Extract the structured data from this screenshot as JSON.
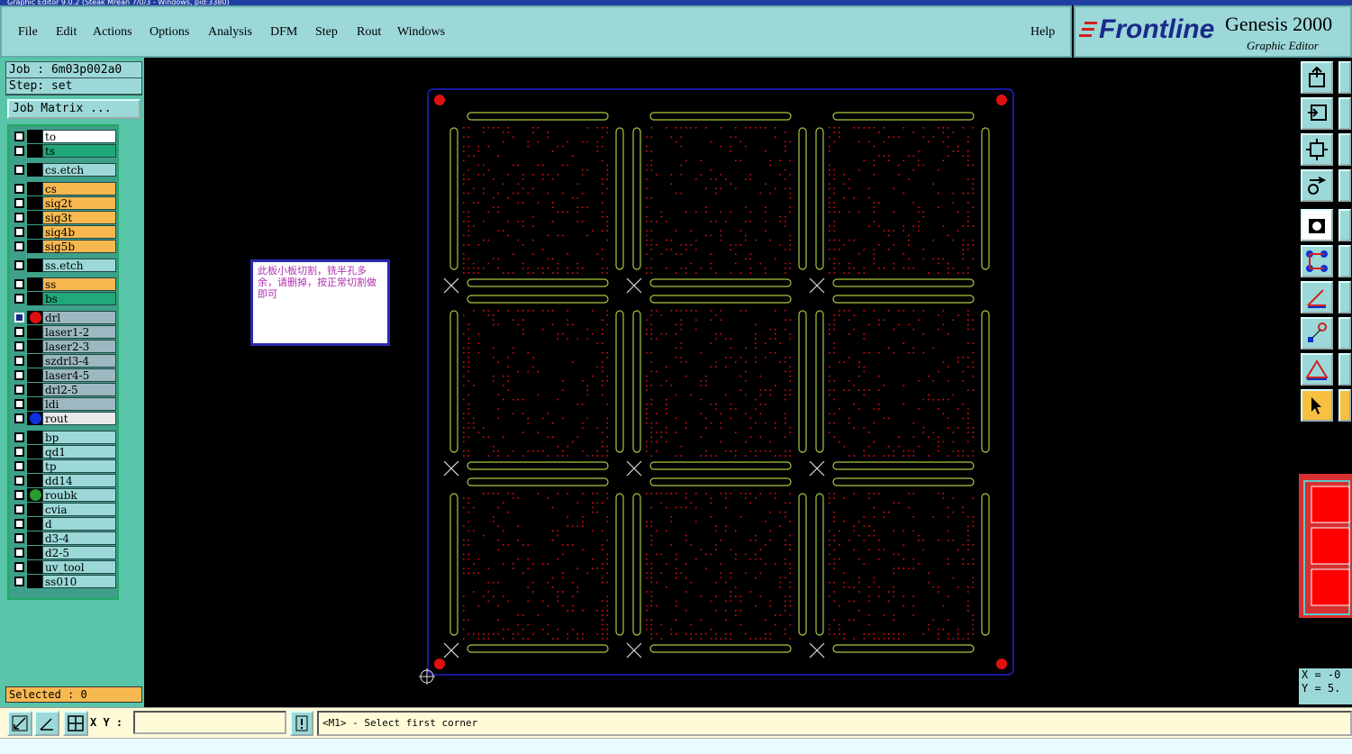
{
  "window": {
    "title": "Graphic Editor 9.0.2 (Steak Mrean 7/0/3 - Windows, pid:3380)"
  },
  "menu": {
    "items": [
      {
        "label": "File"
      },
      {
        "label": "Edit"
      },
      {
        "label": "Actions"
      },
      {
        "label": "Options"
      },
      {
        "label": "Analysis"
      },
      {
        "label": "DFM"
      },
      {
        "label": "Step"
      },
      {
        "label": "Rout"
      },
      {
        "label": "Windows"
      }
    ],
    "help": "Help"
  },
  "brand": {
    "logo": "Frontline",
    "product": "Genesis 2000",
    "subtitle": "Graphic Editor"
  },
  "job": {
    "job_line": "Job : 6m03p002a0",
    "step_line": "Step: set",
    "matrix_button": "Job Matrix ..."
  },
  "layers": [
    {
      "name": "to",
      "color": "#ffffff",
      "dot": ""
    },
    {
      "name": "ts",
      "color": "#20a878",
      "dot": ""
    },
    {
      "name": "cs.etch",
      "color": "#9cd8d8",
      "dot": ""
    },
    {
      "name": "cs",
      "color": "#f8b850",
      "dot": ""
    },
    {
      "name": "sig2t",
      "color": "#f8b850",
      "dot": ""
    },
    {
      "name": "sig3t",
      "color": "#f8b850",
      "dot": ""
    },
    {
      "name": "sig4b",
      "color": "#f8b850",
      "dot": ""
    },
    {
      "name": "sig5b",
      "color": "#f8b850",
      "dot": ""
    },
    {
      "name": "ss.etch",
      "color": "#9cd8d8",
      "dot": ""
    },
    {
      "name": "ss",
      "color": "#f8b850",
      "dot": ""
    },
    {
      "name": "bs",
      "color": "#20a878",
      "dot": ""
    },
    {
      "name": "drl",
      "color": "#9cb8c0",
      "dot": "#e01010",
      "active": true
    },
    {
      "name": "laser1-2",
      "color": "#9cb8c0",
      "dot": ""
    },
    {
      "name": "laser2-3",
      "color": "#9cb8c0",
      "dot": ""
    },
    {
      "name": "szdrl3-4",
      "color": "#9cb8c0",
      "dot": ""
    },
    {
      "name": "laser4-5",
      "color": "#9cb8c0",
      "dot": ""
    },
    {
      "name": "drl2-5",
      "color": "#9cb8c0",
      "dot": ""
    },
    {
      "name": "ldi",
      "color": "#9cb8c0",
      "dot": ""
    },
    {
      "name": "rout",
      "color": "#e8e8e8",
      "dot": "#1030e0"
    },
    {
      "name": "bp",
      "color": "#9cd8d8",
      "dot": ""
    },
    {
      "name": "qd1",
      "color": "#9cd8d8",
      "dot": ""
    },
    {
      "name": "tp",
      "color": "#9cd8d8",
      "dot": ""
    },
    {
      "name": "dd14",
      "color": "#9cd8d8",
      "dot": ""
    },
    {
      "name": "roubk",
      "color": "#9cd8d8",
      "dot": "#2a9a30"
    },
    {
      "name": "cvia",
      "color": "#9cd8d8",
      "dot": ""
    },
    {
      "name": "d",
      "color": "#9cd8d8",
      "dot": ""
    },
    {
      "name": "d3-4",
      "color": "#9cd8d8",
      "dot": ""
    },
    {
      "name": "d2-5",
      "color": "#9cd8d8",
      "dot": ""
    },
    {
      "name": "uv_tool",
      "color": "#9cd8d8",
      "dot": ""
    },
    {
      "name": "ss010",
      "color": "#9cd8d8",
      "dot": ""
    }
  ],
  "selected": "Selected : 0",
  "note": {
    "text": "此板小板切割，铣半孔多余，请删掉，按正常切割做即可"
  },
  "coords": {
    "x": "X = -0",
    "y": "Y = 5."
  },
  "bottom": {
    "xy_label": "X Y :",
    "xy_value": "",
    "prompt": "<M1> - Select first corner"
  },
  "colors": {
    "panel_bg": "#58c4a8",
    "menu_bg": "#9cd8d8",
    "board_outline": "#2020d0",
    "drill": "#e01010",
    "slot": "#a8c840"
  }
}
